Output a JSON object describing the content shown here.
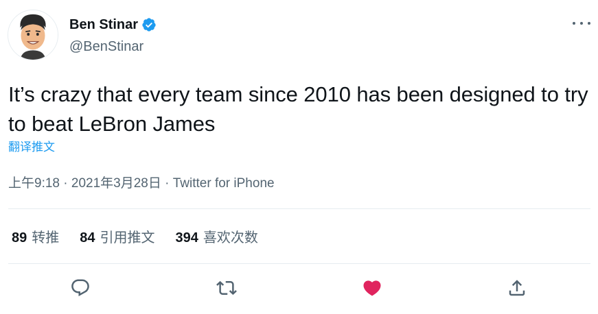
{
  "author": {
    "display_name": "Ben Stinar",
    "handle": "@BenStinar",
    "verified": true
  },
  "tweet": {
    "text": "It’s crazy that every team since 2010 has been designed to try to beat LeBron James",
    "translate_label": "翻译推文",
    "time": "上午9:18",
    "separator": " · ",
    "date": "2021年3月28日",
    "source": "Twitter for iPhone"
  },
  "stats": {
    "retweets_count": "89",
    "retweets_label": "转推",
    "quotes_count": "84",
    "quotes_label": "引用推文",
    "likes_count": "394",
    "likes_label": "喜欢次数"
  },
  "icons": {
    "more": "more-horizontal-icon",
    "verified": "verified-badge-icon",
    "reply": "reply-icon",
    "retweet": "retweet-icon",
    "like": "heart-filled-icon",
    "share": "share-icon"
  },
  "colors": {
    "text": "#0f1419",
    "secondary": "#536471",
    "link": "#1d9bf0",
    "verified": "#1d9bf0",
    "like_active": "#e0245e",
    "divider": "#e6ecf0"
  }
}
